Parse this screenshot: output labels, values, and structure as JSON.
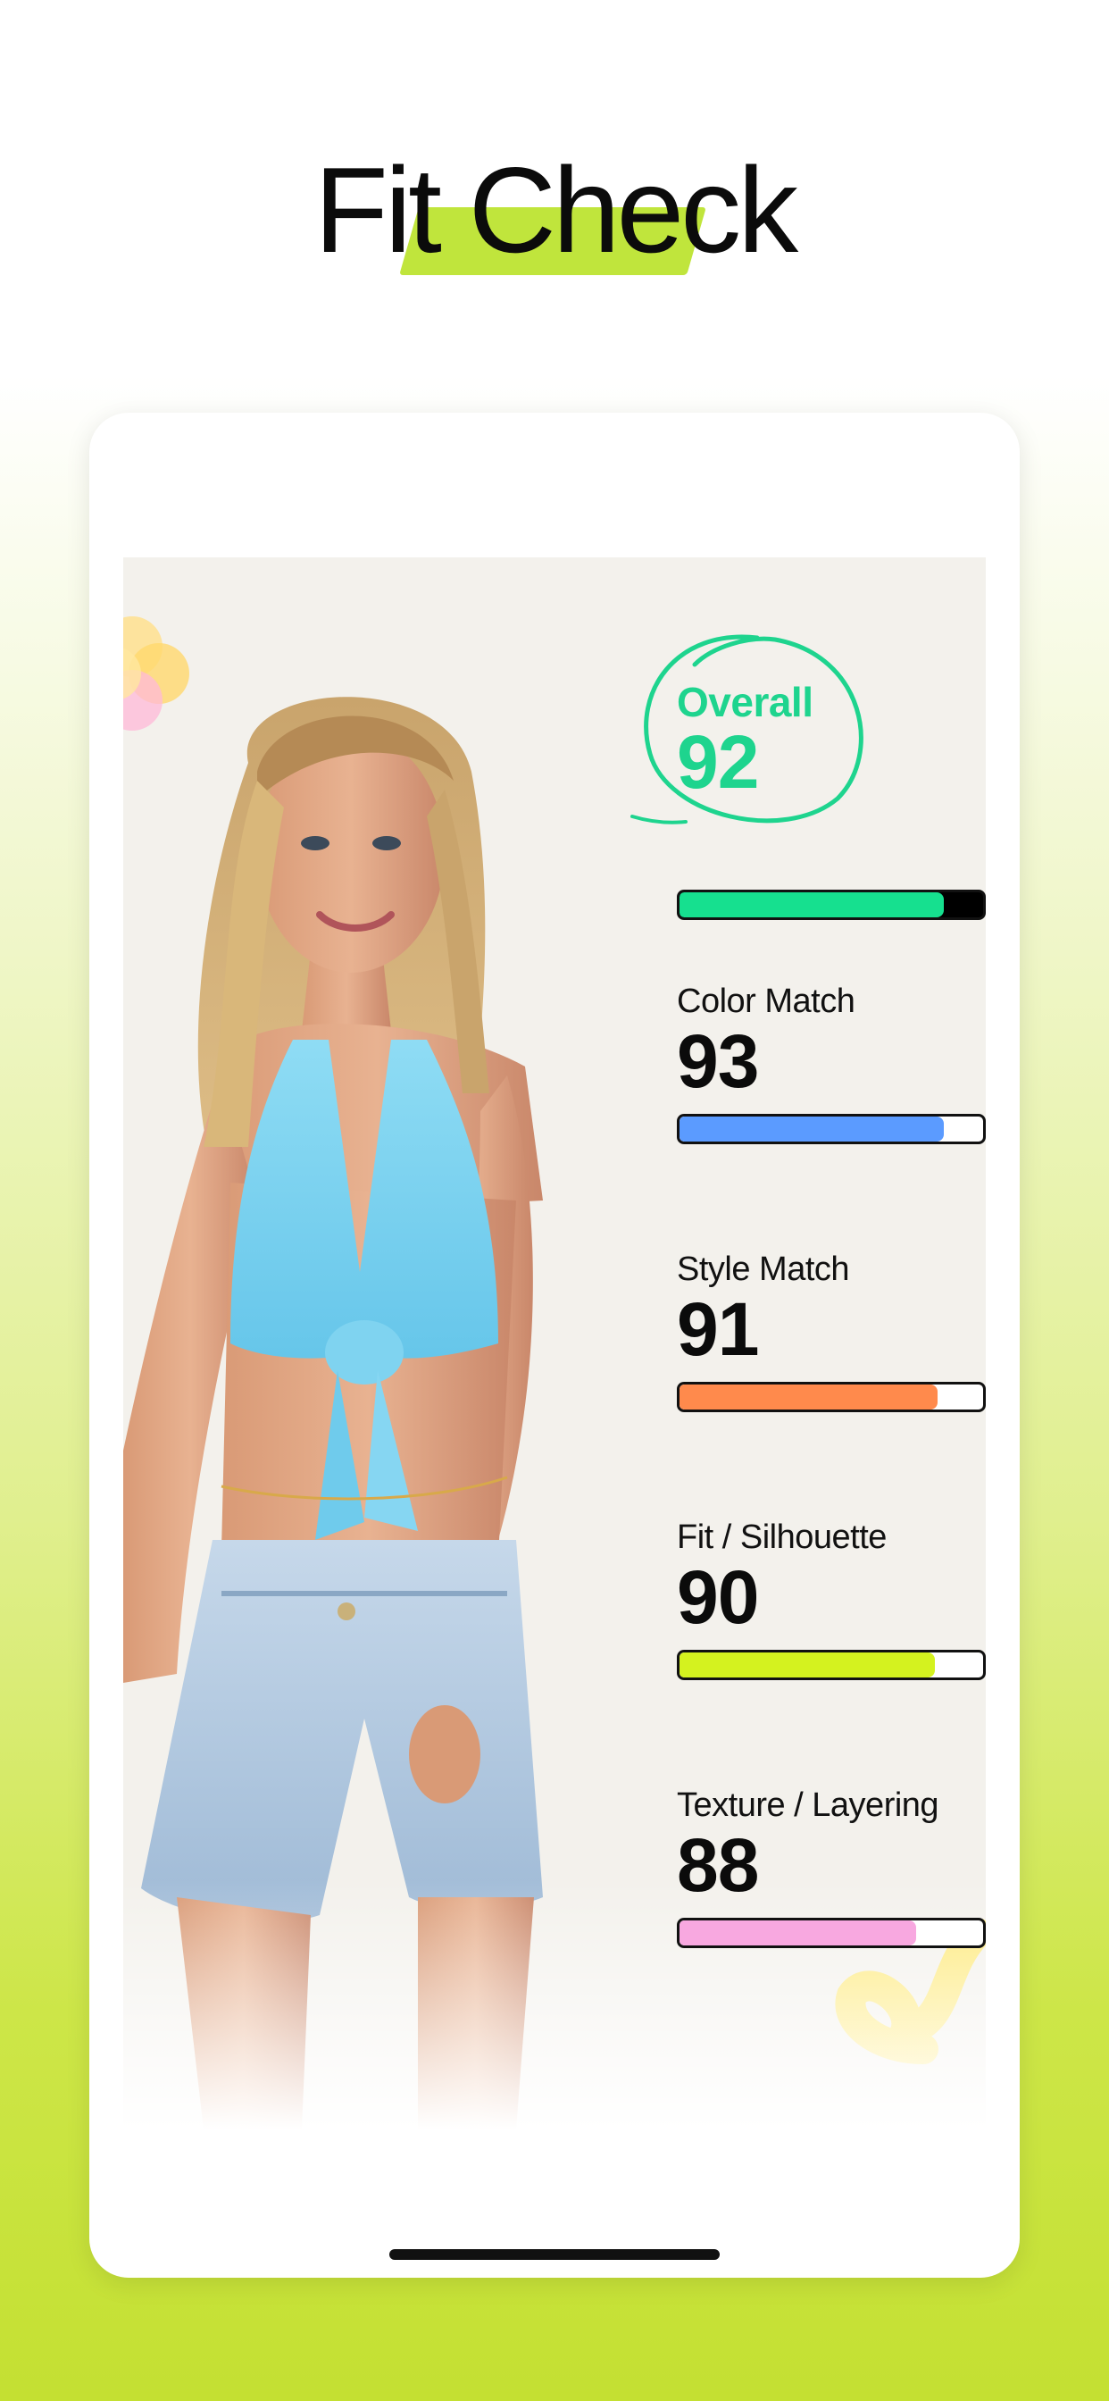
{
  "header": {
    "title": "Fit Check"
  },
  "colors": {
    "highlight": "#c0e53c",
    "overall": "#16e08f",
    "color_match": "#5b9bff",
    "style_match": "#ff8a4c",
    "fit": "#d4f21f",
    "texture": "#f8a8e0"
  },
  "scores": {
    "overall": {
      "label": "Overall",
      "value": "92",
      "percent": 87
    },
    "color_match": {
      "label": "Color Match",
      "value": "93",
      "percent": 87
    },
    "style_match": {
      "label": "Style Match",
      "value": "91",
      "percent": 85
    },
    "fit": {
      "label": "Fit / Silhouette",
      "value": "90",
      "percent": 84
    },
    "texture": {
      "label": "Texture / Layering",
      "value": "88",
      "percent": 78
    }
  }
}
